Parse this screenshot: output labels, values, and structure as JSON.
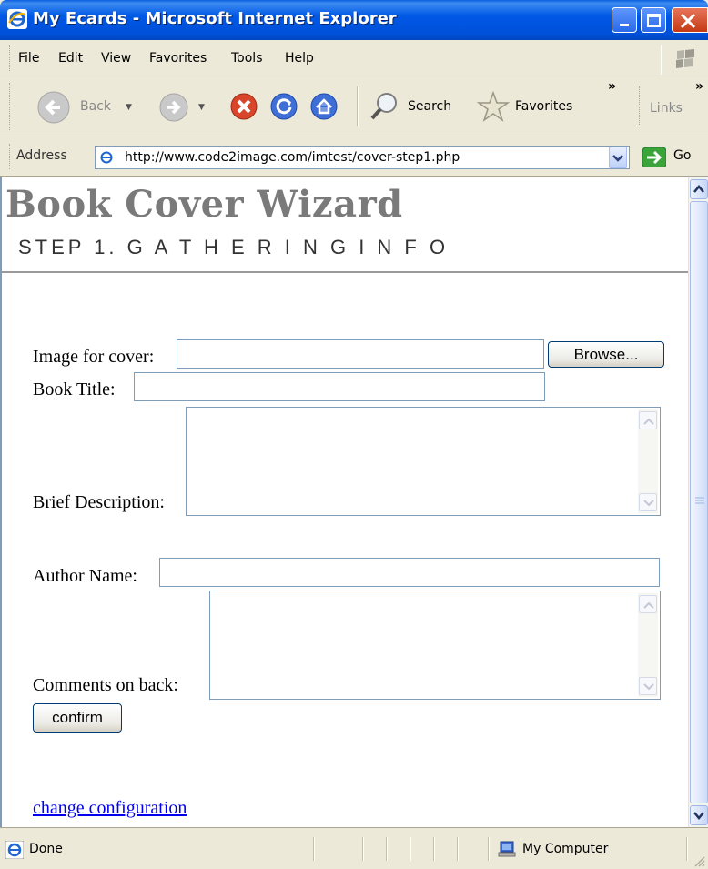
{
  "window": {
    "title": "My Ecards - Microsoft Internet Explorer"
  },
  "menu": {
    "items": [
      "File",
      "Edit",
      "View",
      "Favorites",
      "Tools",
      "Help"
    ]
  },
  "toolbar": {
    "back_label": "Back",
    "search_label": "Search",
    "favorites_label": "Favorites",
    "links_label": "Links",
    "overflow_glyph": "»"
  },
  "address": {
    "label": "Address",
    "url": "http://www.code2image.com/imtest/cover-step1.php",
    "go_label": "Go"
  },
  "page": {
    "title": "Book Cover Wizard",
    "subtitle": "STEP 1. G A T H E R I N G   I N F O",
    "form": {
      "image_label": "Image for cover:",
      "browse_label": "Browse...",
      "title_label": "Book Title:",
      "description_label": "Brief Description:",
      "author_label": "Author Name:",
      "comments_label": "Comments on back:",
      "confirm_label": "confirm"
    },
    "change_config_link": "change configuration"
  },
  "status": {
    "text": "Done",
    "zone": "My Computer"
  }
}
